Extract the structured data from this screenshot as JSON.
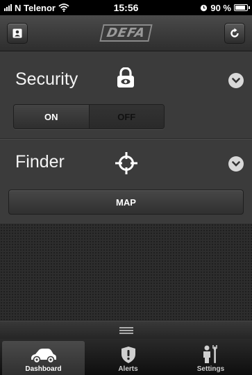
{
  "status_bar": {
    "carrier": "N Telenor",
    "time": "15:56",
    "battery_text": "90 %",
    "battery_level": 0.9
  },
  "nav": {
    "logo_text": "DEFA"
  },
  "security": {
    "title": "Security",
    "toggle_on_label": "ON",
    "toggle_off_label": "OFF",
    "selected": "ON"
  },
  "finder": {
    "title": "Finder",
    "map_label": "MAP"
  },
  "tabs": [
    {
      "label": "Dashboard",
      "icon": "car-icon",
      "active": true
    },
    {
      "label": "Alerts",
      "icon": "shield-alert-icon",
      "active": false
    },
    {
      "label": "Settings",
      "icon": "person-wrench-icon",
      "active": false
    }
  ],
  "colors": {
    "background": "#3b3b3b",
    "status_bar": "#000000",
    "text": "#ffffff"
  }
}
